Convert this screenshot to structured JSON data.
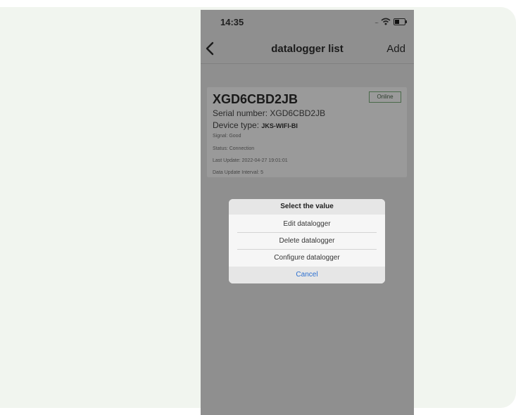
{
  "status_bar": {
    "time": "14:35",
    "signal": "....",
    "wifi_icon": "wifi-icon",
    "battery_icon": "battery-icon"
  },
  "navbar": {
    "back_icon": "chevron-left-icon",
    "title": "datalogger list",
    "add_label": "Add"
  },
  "datalogger": {
    "name": "XGD6CBD2JB",
    "status_badge": "Online",
    "serial_label": "Serial number: ",
    "serial_value": "XGD6CBD2JB",
    "device_type_label": "Device type: ",
    "device_type_value": "JKS-WIFI-BI",
    "signal": "Signal: Good",
    "status": "Status: Connection",
    "last_update": "Last Update: 2022-04-27 19:01:01",
    "update_interval": "Data Update Interval: 5"
  },
  "dialog": {
    "title": "Select the value",
    "options": [
      "Edit datalogger",
      "Delete datalogger",
      "Configure datalogger"
    ],
    "cancel": "Cancel"
  },
  "colors": {
    "page_background": "#f1f5ef",
    "overlay": "#8f8f8f",
    "cancel_blue": "#2b6fd0",
    "online_green": "#4a6a4a"
  }
}
